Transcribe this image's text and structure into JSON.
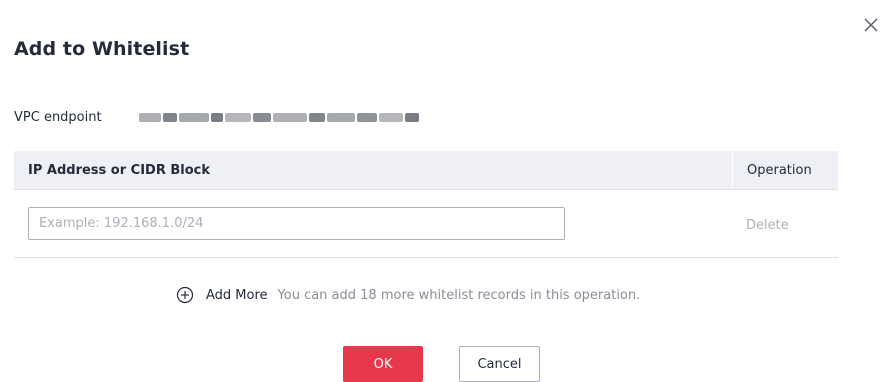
{
  "dialog": {
    "title": "Add to Whitelist",
    "close_icon": "close-icon"
  },
  "vpc": {
    "label": "VPC endpoint",
    "value_obscured": true
  },
  "table": {
    "columns": [
      "IP Address or CIDR Block",
      "Operation"
    ],
    "rows": [
      {
        "ip_value": "",
        "ip_placeholder": "Example: 192.168.1.0/24",
        "action": "Delete"
      }
    ]
  },
  "add_more": {
    "icon": "plus-circle-icon",
    "label": "Add More",
    "hint": "You can add 18 more whitelist records in this operation."
  },
  "footer": {
    "ok_label": "OK",
    "cancel_label": "Cancel"
  },
  "colors": {
    "primary": "#e6384b",
    "header_bg": "#eef0f5",
    "text": "#252b3a",
    "muted": "#adb0b8"
  }
}
